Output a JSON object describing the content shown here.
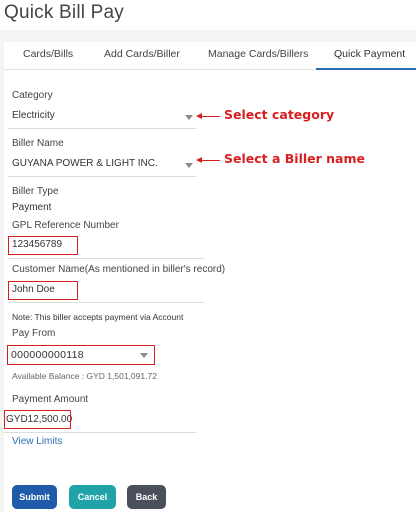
{
  "page": {
    "title": "Quick Bill Pay"
  },
  "tabs": [
    {
      "label": "Cards/Bills",
      "active": false
    },
    {
      "label": "Add Cards/Biller",
      "active": false
    },
    {
      "label": "Manage Cards/Billers",
      "active": false
    },
    {
      "label": "Quick Payment",
      "active": true
    }
  ],
  "form": {
    "category": {
      "label": "Category",
      "value": "Electricity"
    },
    "biller_name": {
      "label": "Biller Name",
      "value": "GUYANA POWER & LIGHT INC."
    },
    "biller_type": {
      "label": "Biller Type",
      "value": "Payment"
    },
    "reference": {
      "label": "GPL Reference Number",
      "value": "123456789"
    },
    "customer_name": {
      "label": "Customer Name(As mentioned in biller's record)",
      "value": "John Doe"
    },
    "note": "Note: This biller accepts payment via Account",
    "pay_from": {
      "label": "Pay From",
      "value": "000000000118"
    },
    "balance": "Available Balance : GYD 1,501,091.72",
    "amount": {
      "label": "Payment Amount",
      "value": "GYD12,500.00"
    },
    "view_limits": "View Limits"
  },
  "annotations": {
    "category": "Select category",
    "biller": "Select a Biller name"
  },
  "buttons": {
    "submit": "Submit",
    "cancel": "Cancel",
    "back": "Back"
  },
  "colors": {
    "accent": "#2d6fb6",
    "annotation": "#d81e1e",
    "submit": "#1f5ba8",
    "cancel": "#20a3a8",
    "back": "#4b4f5b"
  }
}
